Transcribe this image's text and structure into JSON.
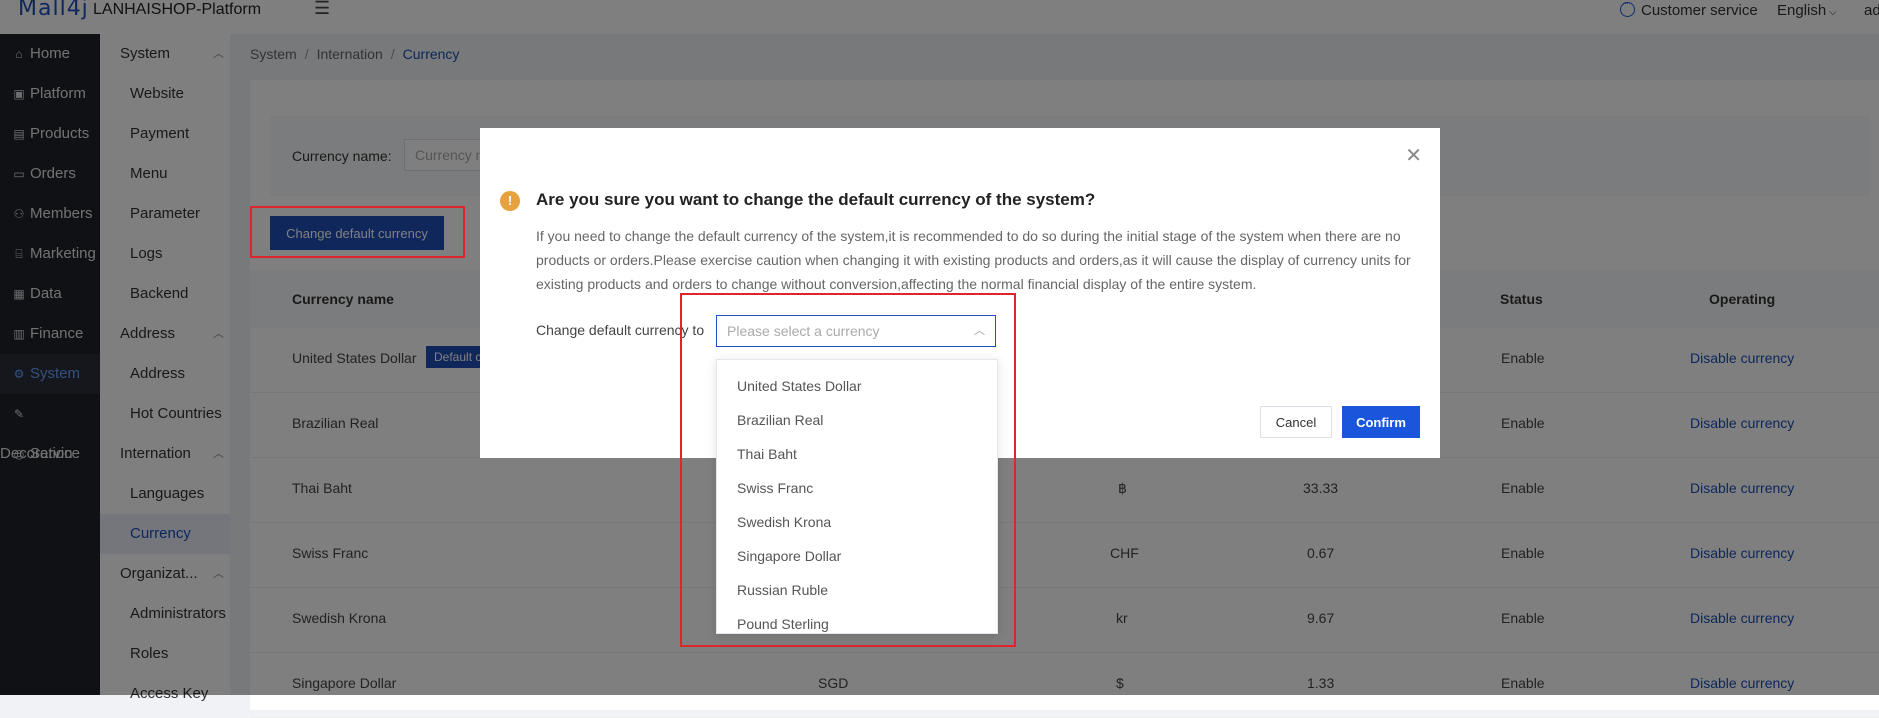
{
  "header": {
    "logo": "Mall4j",
    "title": "LANHAISHOP-Platform",
    "customer_service": "Customer service",
    "language": "English",
    "user": "ad"
  },
  "sidebar": {
    "items": [
      {
        "label": "Home",
        "icon": "home-icon"
      },
      {
        "label": "Platform",
        "icon": "platform-icon"
      },
      {
        "label": "Products",
        "icon": "products-icon"
      },
      {
        "label": "Orders",
        "icon": "orders-icon"
      },
      {
        "label": "Members",
        "icon": "members-icon"
      },
      {
        "label": "Marketing",
        "icon": "marketing-icon"
      },
      {
        "label": "Data",
        "icon": "data-icon"
      },
      {
        "label": "Finance",
        "icon": "finance-icon"
      },
      {
        "label": "System",
        "icon": "gear-icon"
      },
      {
        "label": "Decoration",
        "icon": "decoration-icon"
      },
      {
        "label": "Service",
        "icon": "service-icon"
      }
    ]
  },
  "subnav": {
    "system_group": "System",
    "system_items": [
      "Website",
      "Payment",
      "Menu",
      "Parameter",
      "Logs",
      "Backend"
    ],
    "address_group": "Address",
    "address_items": [
      "Address",
      "Hot Countries"
    ],
    "internation_group": "Internation",
    "internation_items": [
      "Languages",
      "Currency"
    ],
    "organization_group": "Organizat...",
    "organization_items": [
      "Administrators",
      "Roles",
      "Access Key"
    ]
  },
  "breadcrumb": [
    "System",
    "Internation",
    "Currency"
  ],
  "search": {
    "label": "Currency name:",
    "placeholder": "Currency n"
  },
  "change_default_button": "Change default currency",
  "table": {
    "headers": {
      "name": "Currency name",
      "status": "Status",
      "operating": "Operating"
    },
    "default_badge": "Default c",
    "rows": [
      {
        "name": "United States Dollar",
        "code": "",
        "symbol": "",
        "rate": "",
        "status": "Enable",
        "action": "Disable currency"
      },
      {
        "name": "Brazilian Real",
        "code": "",
        "symbol": "",
        "rate": "",
        "status": "Enable",
        "action": "Disable currency"
      },
      {
        "name": "Thai Baht",
        "code": "",
        "symbol": "฿",
        "rate": "33.33",
        "status": "Enable",
        "action": "Disable currency"
      },
      {
        "name": "Swiss Franc",
        "code": "",
        "symbol": "CHF",
        "rate": "0.67",
        "status": "Enable",
        "action": "Disable currency"
      },
      {
        "name": "Swedish Krona",
        "code": "",
        "symbol": "kr",
        "rate": "9.67",
        "status": "Enable",
        "action": "Disable currency"
      },
      {
        "name": "Singapore Dollar",
        "code": "SGD",
        "symbol": "$",
        "rate": "1.33",
        "status": "Enable",
        "action": "Disable currency"
      }
    ]
  },
  "dialog": {
    "title": "Are you sure you want to change the default currency of the system?",
    "message": "If you need to change the default currency of the system,it is recommended to do so during the initial stage of the system when there are no products or orders.Please exercise caution when changing it with existing products and orders,as it will cause the display of currency units for existing products and orders to change without conversion,affecting the normal financial display of the entire system.",
    "label": "Change default currency to",
    "select_placeholder": "Please select a currency",
    "cancel": "Cancel",
    "confirm": "Confirm",
    "options": [
      "United States Dollar",
      "Brazilian Real",
      "Thai Baht",
      "Swiss Franc",
      "Swedish Krona",
      "Singapore Dollar",
      "Russian Ruble",
      "Pound Sterling"
    ]
  },
  "colors": {
    "accent": "#1f4fb7",
    "highlight": "#e0242b",
    "warning": "#e6a23c"
  }
}
